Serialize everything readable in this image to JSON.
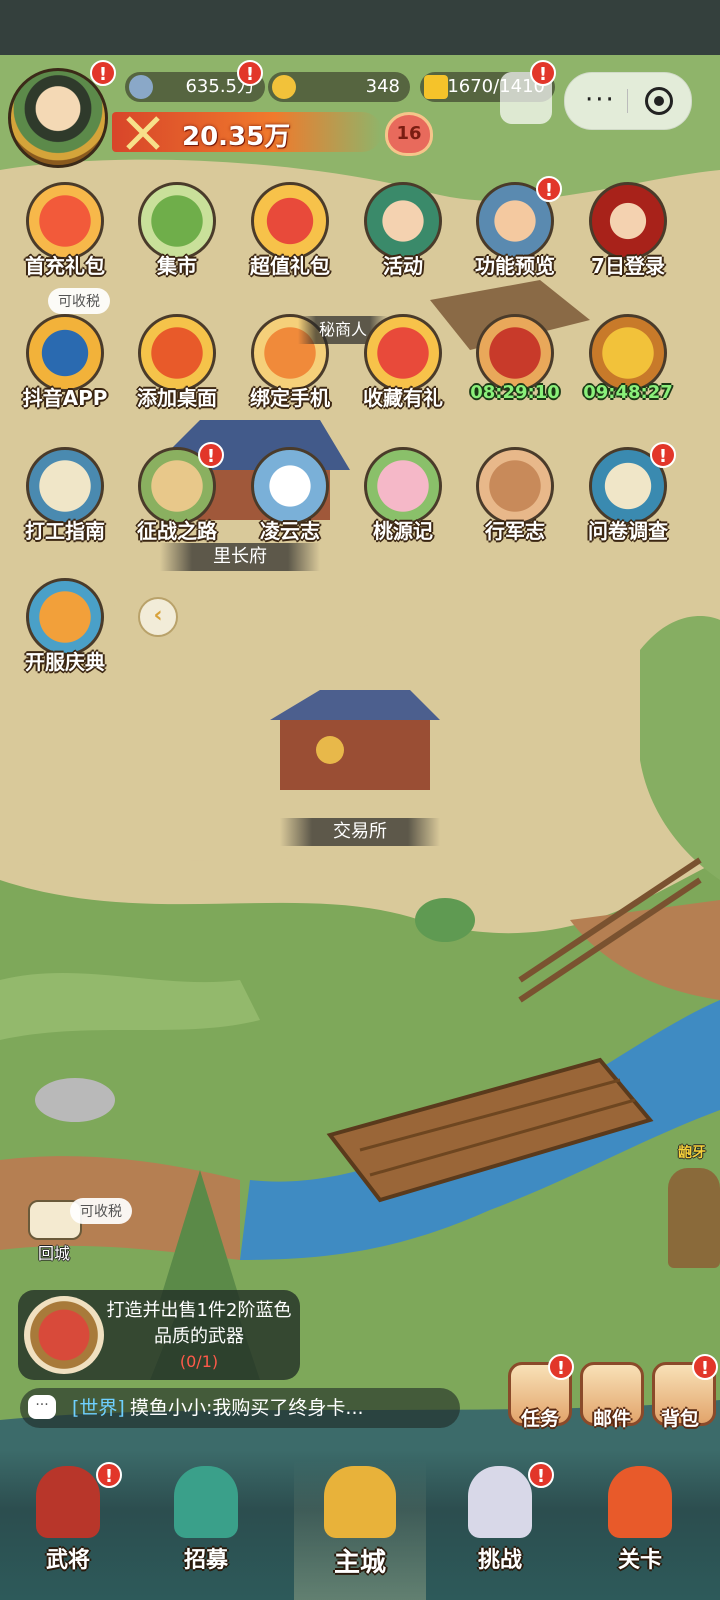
{
  "header": {
    "silver": "635.5万",
    "gold": "348",
    "stamina": "1670/1410",
    "power": "20.35万",
    "level": "16"
  },
  "icons_row1": [
    "首充礼包",
    "集市",
    "超值礼包",
    "活动",
    "功能预览",
    "7日登录"
  ],
  "icons_row2": [
    "抖音APP",
    "添加桌面",
    "绑定手机",
    "收藏有礼"
  ],
  "timers": [
    "08:29:10",
    "09:48:27"
  ],
  "icons_row3": [
    "打工指南",
    "征战之路",
    "凌云志",
    "桃源记",
    "行军志",
    "问卷调查"
  ],
  "icons_row4": [
    "开服庆典"
  ],
  "map": {
    "taxable1": "可收税",
    "secret_shop": "秘商人",
    "village_hall": "里长府",
    "exchange": "交易所",
    "return_city": "回城",
    "taxable2": "可收税",
    "npc": "龅牙"
  },
  "quest": {
    "text": "打造并出售1件2阶蓝色品质的武器",
    "progress": "(0/1)"
  },
  "chat": {
    "channel": "[世界]",
    "message": "摸鱼小小:我购买了终身卡..."
  },
  "side_buttons": [
    "任务",
    "邮件",
    "背包"
  ],
  "nav": [
    "武将",
    "招募",
    "主城",
    "挑战",
    "关卡"
  ],
  "badge": "!",
  "colors": {
    "accent": "#f07a2c",
    "badge": "#e2362a",
    "timer": "#8af07a"
  }
}
